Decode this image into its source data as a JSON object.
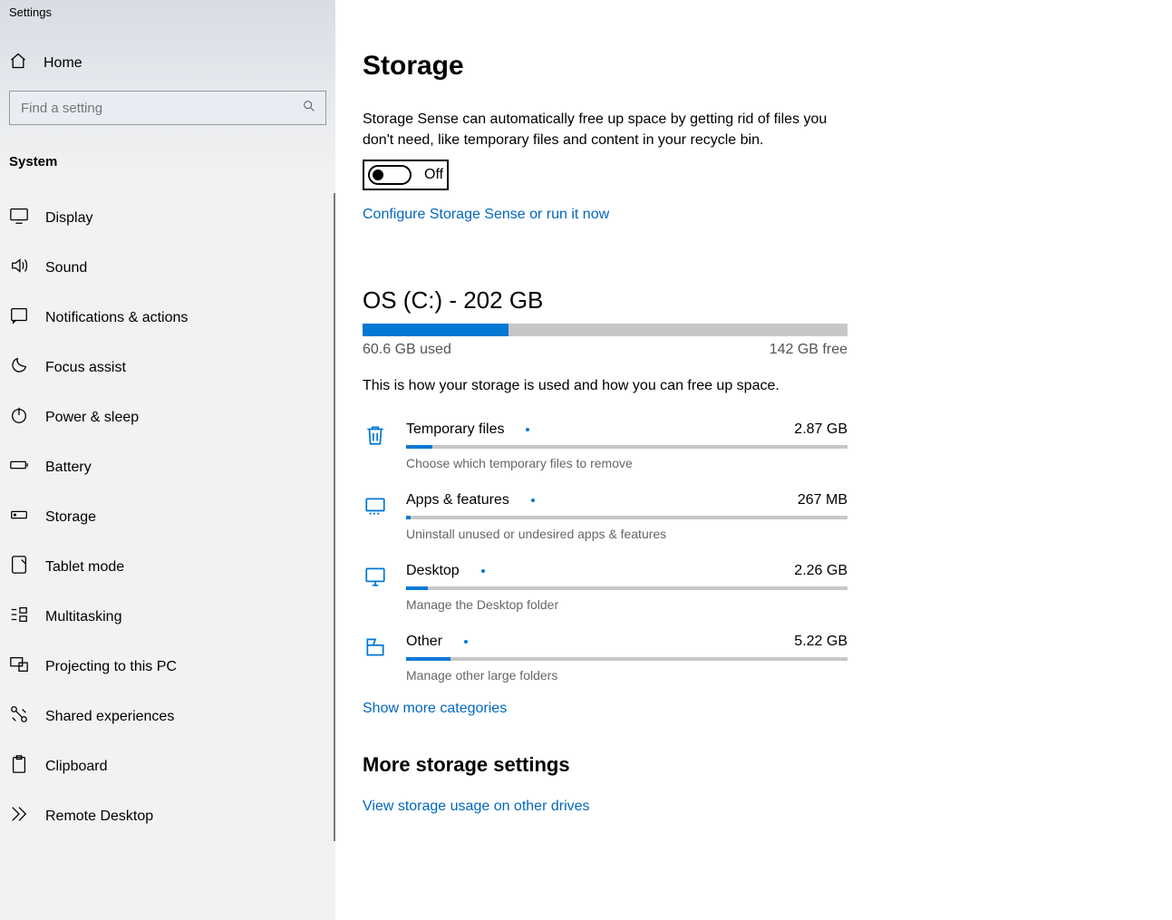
{
  "app": {
    "title": "Settings"
  },
  "sidebar": {
    "home_label": "Home",
    "search_placeholder": "Find a setting",
    "section_label": "System",
    "items": [
      {
        "label": "Display"
      },
      {
        "label": "Sound"
      },
      {
        "label": "Notifications & actions"
      },
      {
        "label": "Focus assist"
      },
      {
        "label": "Power & sleep"
      },
      {
        "label": "Battery"
      },
      {
        "label": "Storage"
      },
      {
        "label": "Tablet mode"
      },
      {
        "label": "Multitasking"
      },
      {
        "label": "Projecting to this PC"
      },
      {
        "label": "Shared experiences"
      },
      {
        "label": "Clipboard"
      },
      {
        "label": "Remote Desktop"
      }
    ]
  },
  "page": {
    "title": "Storage",
    "sense_desc": "Storage Sense can automatically free up space by getting rid of files you don't need, like temporary files and content in your recycle bin.",
    "toggle_state": "Off",
    "configure_link": "Configure Storage Sense or run it now",
    "drive": {
      "title": "OS (C:) - 202 GB",
      "used_label": "60.6 GB used",
      "free_label": "142 GB free",
      "used_gb": 60.6,
      "total_gb": 202,
      "fill_percent": 30
    },
    "drive_desc": "This is how your storage is used and how you can free up space.",
    "categories": [
      {
        "name": "Temporary files",
        "size": "2.87 GB",
        "sub": "Choose which temporary files to remove",
        "fill_percent": 6
      },
      {
        "name": "Apps & features",
        "size": "267 MB",
        "sub": "Uninstall unused or undesired apps & features",
        "fill_percent": 1
      },
      {
        "name": "Desktop",
        "size": "2.26 GB",
        "sub": "Manage the Desktop folder",
        "fill_percent": 5
      },
      {
        "name": "Other",
        "size": "5.22 GB",
        "sub": "Manage other large folders",
        "fill_percent": 10
      }
    ],
    "show_more": "Show more categories",
    "more_heading": "More storage settings",
    "more_link": "View storage usage on other drives"
  },
  "colors": {
    "accent": "#0078d4",
    "link": "#0067c0"
  }
}
